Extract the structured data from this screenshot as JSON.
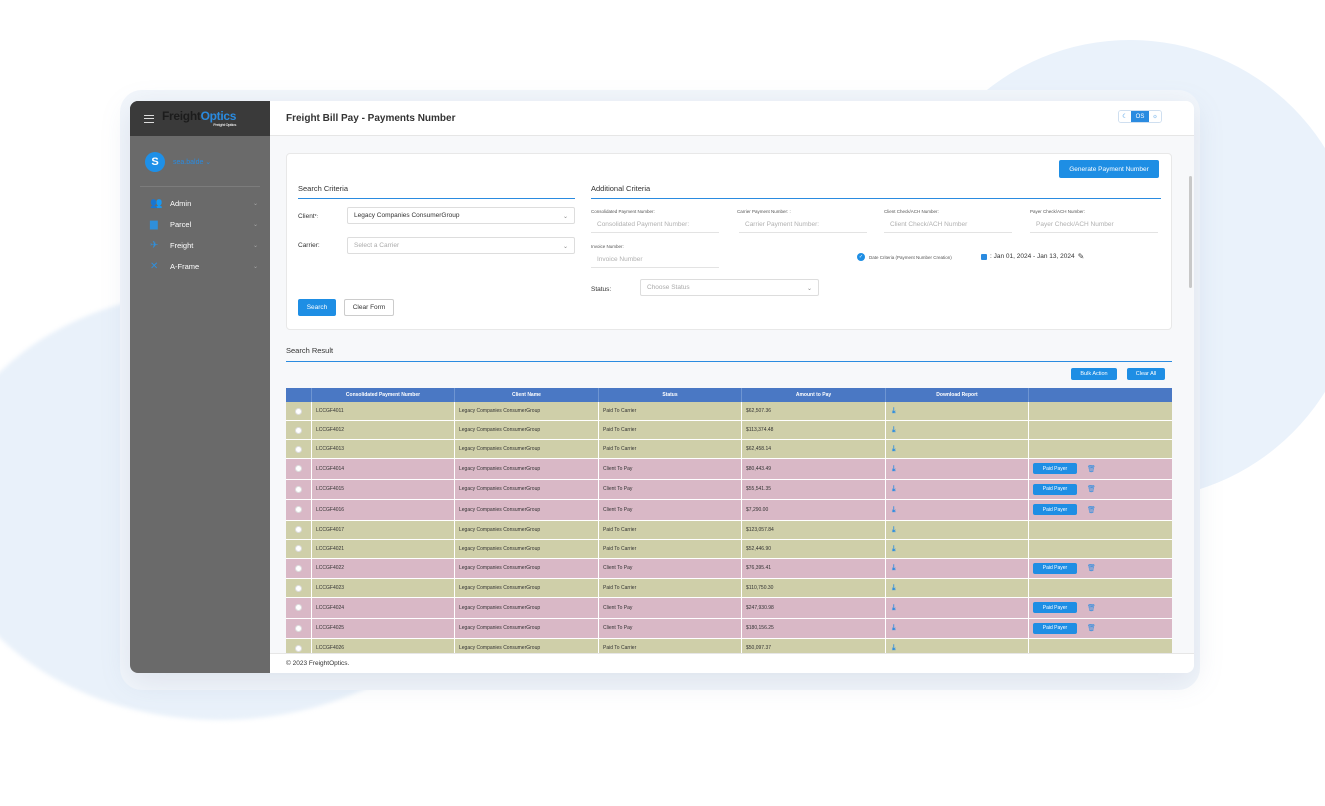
{
  "app": {
    "title": "Freight Bill Pay - Payments Number",
    "logo_main": "Freight",
    "logo_accent": "Optics",
    "logo_sub": "Freight Optics",
    "theme_toggle": [
      "☾",
      "OS",
      "☼"
    ]
  },
  "user": {
    "initial": "S",
    "name": "sea.balde ⌄"
  },
  "sidebar": {
    "items": [
      {
        "label": "Admin",
        "icon": "users-icon"
      },
      {
        "label": "Parcel",
        "icon": "truck-icon"
      },
      {
        "label": "Freight",
        "icon": "plane-icon"
      },
      {
        "label": "A-Frame",
        "icon": "crossed-icon"
      }
    ]
  },
  "form": {
    "generate_button": "Generate Payment Number",
    "search_criteria_title": "Search Criteria",
    "additional_criteria_title": "Additional Criteria",
    "client_label": "Client",
    "client_required": "*:",
    "client_value": "Legacy Companies ConsumerGroup",
    "carrier_label": "Carrier:",
    "carrier_placeholder": "Select a Carrier",
    "consolidated_label": "Consolidated Payment Number:",
    "consolidated_placeholder": "Consolidated Payment Number:",
    "carrier_payment_label": "Carrier Payment Number: :",
    "carrier_payment_placeholder": "Carrier Payment Number:",
    "client_check_label": "Client Check/ACH Number:",
    "client_check_placeholder": "Client Check/ACH Number",
    "payer_check_label": "Payer Check/ACH Number:",
    "payer_check_placeholder": "Payer Check/ACH Number",
    "invoice_label": "Invoice Number:",
    "invoice_placeholder": "Invoice Number",
    "date_criteria_label": "Date Criteria (Payment Number Creation)",
    "date_range": ": Jan 01, 2024 - Jan 13, 2024",
    "status_label": "Status:",
    "status_placeholder": "Choose Status",
    "search_button": "Search",
    "clear_button": "Clear Form"
  },
  "results": {
    "title": "Search Result",
    "bulk_action": "Bulk Action",
    "clear_all": "Clear All",
    "columns": [
      "Consolidated Payment Number",
      "Client Name",
      "Status",
      "Amount to Pay",
      "Download Report",
      ""
    ],
    "paid_payer_label": "Paid Payer",
    "rows": [
      {
        "number": "LCCGF4011",
        "client": "Legacy Companies ConsumerGroup",
        "status": "Paid To Carrier",
        "amount": "$62,507.36",
        "type": "green"
      },
      {
        "number": "LCCGF4012",
        "client": "Legacy Companies ConsumerGroup",
        "status": "Paid To Carrier",
        "amount": "$113,374.48",
        "type": "green"
      },
      {
        "number": "LCCGF4013",
        "client": "Legacy Companies ConsumerGroup",
        "status": "Paid To Carrier",
        "amount": "$62,458.14",
        "type": "green"
      },
      {
        "number": "LCCGF4014",
        "client": "Legacy Companies ConsumerGroup",
        "status": "Client To Pay",
        "amount": "$80,443.49",
        "type": "pink"
      },
      {
        "number": "LCCGF4015",
        "client": "Legacy Companies ConsumerGroup",
        "status": "Client To Pay",
        "amount": "$55,541.35",
        "type": "pink"
      },
      {
        "number": "LCCGF4016",
        "client": "Legacy Companies ConsumerGroup",
        "status": "Client To Pay",
        "amount": "$7,290.00",
        "type": "pink"
      },
      {
        "number": "LCCGF4017",
        "client": "Legacy Companies ConsumerGroup",
        "status": "Paid To Carrier",
        "amount": "$123,057.84",
        "type": "green"
      },
      {
        "number": "LCCGF4021",
        "client": "Legacy Companies ConsumerGroup",
        "status": "Paid To Carrier",
        "amount": "$52,446.90",
        "type": "green"
      },
      {
        "number": "LCCGF4022",
        "client": "Legacy Companies ConsumerGroup",
        "status": "Client To Pay",
        "amount": "$76,395.41",
        "type": "pink"
      },
      {
        "number": "LCCGF4023",
        "client": "Legacy Companies ConsumerGroup",
        "status": "Paid To Carrier",
        "amount": "$110,750.30",
        "type": "green"
      },
      {
        "number": "LCCGF4024",
        "client": "Legacy Companies ConsumerGroup",
        "status": "Client To Pay",
        "amount": "$247,930.98",
        "type": "pink"
      },
      {
        "number": "LCCGF4025",
        "client": "Legacy Companies ConsumerGroup",
        "status": "Client To Pay",
        "amount": "$180,156.25",
        "type": "pink"
      },
      {
        "number": "LCCGF4026",
        "client": "Legacy Companies ConsumerGroup",
        "status": "Paid To Carrier",
        "amount": "$50,097.37",
        "type": "green"
      }
    ]
  },
  "footer": {
    "copyright": "© 2023 FreightOptics."
  },
  "colors": {
    "accent": "#1e8ee4",
    "green_row": "#cfcfa9",
    "pink_row": "#d9b8c6",
    "header_row": "#4a78c4",
    "sidebar": "#6a6a6a"
  }
}
